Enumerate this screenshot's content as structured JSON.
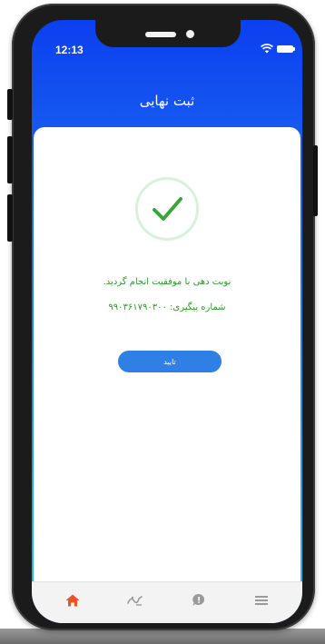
{
  "status_bar": {
    "time": "12:13",
    "icons": [
      "wifi-icon",
      "battery-icon"
    ]
  },
  "header": {
    "title": "ثبت نهایی"
  },
  "result": {
    "icon": "checkmark-icon",
    "message": "نوبت دهی با موفقیت انجام گردید.",
    "tracking_text": "شماره پیگیری: ۹۹۰۳۶۱۷۹۰۳۰۰",
    "confirm_label": "تایید"
  },
  "bottom_nav": {
    "items": [
      {
        "icon": "home-icon",
        "active": true
      },
      {
        "icon": "logo-icon",
        "active": false
      },
      {
        "icon": "chat-icon",
        "active": false
      },
      {
        "icon": "menu-icon",
        "active": false
      }
    ]
  },
  "colors": {
    "header_blue": "#0b3ff0",
    "gradient_bottom": "#29c2ea",
    "success_green": "#2e9a2e",
    "button_blue": "#2f7fe4",
    "active_nav": "#e8542a",
    "inactive_nav": "#9a9a9a"
  }
}
